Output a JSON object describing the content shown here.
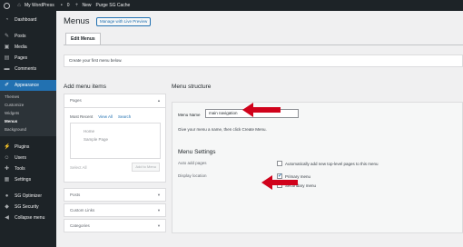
{
  "adminbar": {
    "site_name": "My WordPress",
    "comments_count": "0",
    "new_label": "New",
    "purge_label": "Purge SG Cache"
  },
  "sidebar": {
    "items": [
      {
        "label": "Dashboard",
        "icon": "dashboard-icon"
      },
      {
        "label": "Posts",
        "icon": "pin-icon"
      },
      {
        "label": "Media",
        "icon": "media-icon"
      },
      {
        "label": "Pages",
        "icon": "pages-icon"
      },
      {
        "label": "Comments",
        "icon": "comments-icon"
      },
      {
        "label": "Appearance",
        "icon": "brush-icon"
      },
      {
        "label": "Plugins",
        "icon": "plugins-icon"
      },
      {
        "label": "Users",
        "icon": "users-icon"
      },
      {
        "label": "Tools",
        "icon": "tools-icon"
      },
      {
        "label": "Settings",
        "icon": "settings-icon"
      },
      {
        "label": "SG Optimizer",
        "icon": "sg-optimizer-icon"
      },
      {
        "label": "SG Security",
        "icon": "sg-security-icon"
      },
      {
        "label": "Collapse menu",
        "icon": "collapse-icon"
      }
    ],
    "submenu": [
      "Themes",
      "Customize",
      "Widgets",
      "Menus",
      "Background"
    ]
  },
  "page": {
    "title": "Menus",
    "preview_button": "Manage with Live Preview",
    "tab_edit": "Edit Menus",
    "notice": "Create your first menu below."
  },
  "add_items": {
    "title": "Add menu items",
    "pages_label": "Pages",
    "tabs": [
      "Most Recent",
      "View All",
      "Search"
    ],
    "list": [
      "Home",
      "Sample Page"
    ],
    "select_all": "Select All",
    "add_button": "Add to Menu",
    "posts_label": "Posts",
    "custom_links_label": "Custom Links",
    "categories_label": "Categories"
  },
  "structure": {
    "title": "Menu structure",
    "menu_name_label": "Menu Name",
    "menu_name_value": "main navigation",
    "hint": "Give your menu a name, then click Create Menu.",
    "settings_title": "Menu Settings",
    "auto_add_label": "Auto add pages",
    "auto_add_option": "Automatically add new top-level pages to this menu",
    "display_location_label": "Display location",
    "primary_menu": "Primary menu",
    "primary_checked": true,
    "secondary_menu": "Secondary menu",
    "secondary_checked": false
  },
  "colors": {
    "accent": "#2271b1",
    "annotation_arrow": "#d0021b"
  }
}
